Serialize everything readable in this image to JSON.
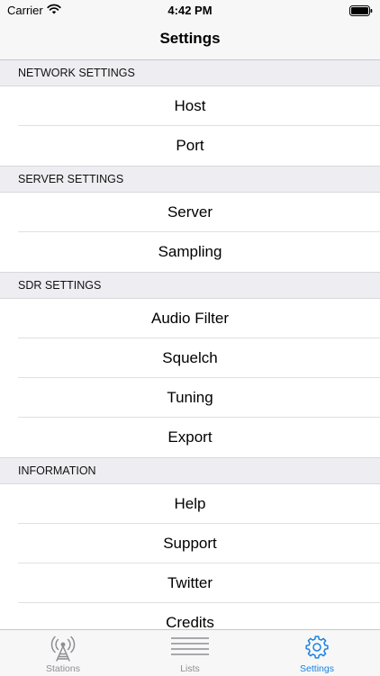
{
  "status_bar": {
    "carrier": "Carrier",
    "time": "4:42 PM"
  },
  "nav": {
    "title": "Settings"
  },
  "sections": [
    {
      "header": "NETWORK SETTINGS",
      "items": [
        "Host",
        "Port"
      ]
    },
    {
      "header": "SERVER SETTINGS",
      "items": [
        "Server",
        "Sampling"
      ]
    },
    {
      "header": "SDR SETTINGS",
      "items": [
        "Audio Filter",
        "Squelch",
        "Tuning",
        "Export"
      ]
    },
    {
      "header": "INFORMATION",
      "items": [
        "Help",
        "Support",
        "Twitter",
        "Credits"
      ]
    }
  ],
  "tabs": [
    {
      "label": "Stations",
      "icon": "antenna-icon",
      "active": false
    },
    {
      "label": "Lists",
      "icon": "list-icon",
      "active": false
    },
    {
      "label": "Settings",
      "icon": "gear-icon",
      "active": true
    }
  ],
  "colors": {
    "accent": "#1a82e2",
    "inactive": "#8e8e93",
    "background": "#f2f2f7"
  }
}
